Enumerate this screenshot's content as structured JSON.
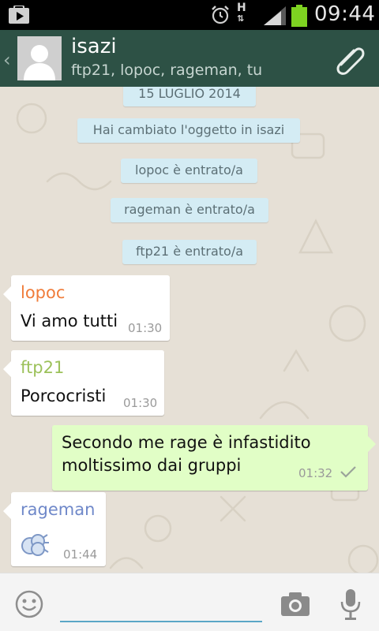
{
  "status_bar": {
    "time": "09:44",
    "network": "H",
    "colors": {
      "battery": "#7ed321"
    }
  },
  "header": {
    "title": "isazi",
    "subtitle": "ftp21, lopoc, rageman, tu",
    "icons": [
      "back-chevron-icon",
      "avatar-icon",
      "paperclip-icon"
    ]
  },
  "chat": {
    "system_messages": [
      "15 LUGLIO 2014",
      "Hai cambiato l'oggetto in isazi",
      "lopoc è entrato/a",
      "rageman è entrato/a",
      "ftp21 è entrato/a"
    ],
    "messages": [
      {
        "direction": "in",
        "sender": "lopoc",
        "sender_color": "#f07c3a",
        "text": "Vi amo tutti",
        "time": "01:30"
      },
      {
        "direction": "in",
        "sender": "ftp21",
        "sender_color": "#9cc15a",
        "text": "Porcocristi",
        "time": "01:30"
      },
      {
        "direction": "out",
        "text_line1": "Secondo me rage è infastidito",
        "text_line2": "moltissimo dai gruppi",
        "time": "01:32",
        "status_icon": "check-icon"
      },
      {
        "direction": "in",
        "sender": "rageman",
        "sender_color": "#6f88c9",
        "content_icon": "fart-cloud-emoji-icon",
        "time": "01:44"
      }
    ]
  },
  "input_bar": {
    "placeholder": "",
    "icons": [
      "emoji-icon",
      "camera-icon",
      "microphone-icon"
    ]
  }
}
